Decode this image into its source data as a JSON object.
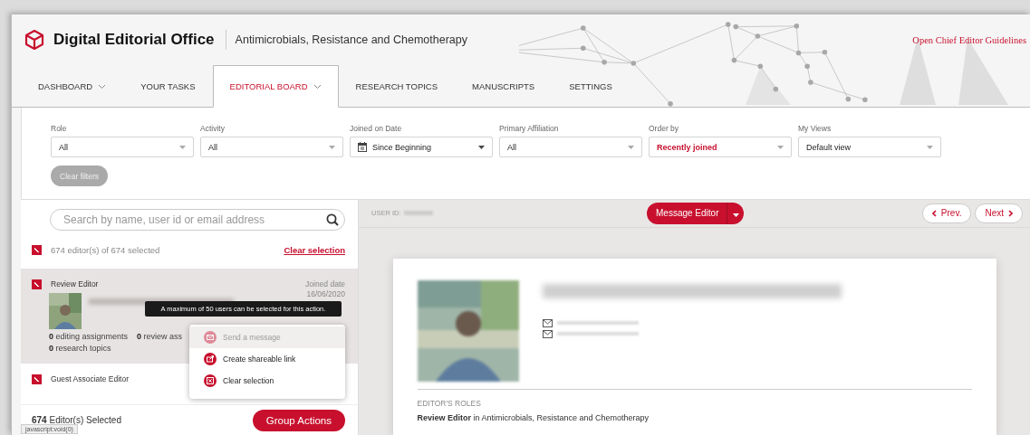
{
  "header": {
    "title": "Digital Editorial Office",
    "journal": "Antimicrobials, Resistance and Chemotherapy",
    "guidelines_link": "Open Chief Editor Guidelines"
  },
  "tabs": [
    {
      "label": "DASHBOARD",
      "dropdown": true,
      "selected": false
    },
    {
      "label": "YOUR TASKS",
      "dropdown": false,
      "selected": false
    },
    {
      "label": "EDITORIAL BOARD",
      "dropdown": true,
      "selected": true
    },
    {
      "label": "RESEARCH TOPICS",
      "dropdown": false,
      "selected": false
    },
    {
      "label": "MANUSCRIPTS",
      "dropdown": false,
      "selected": false
    },
    {
      "label": "SETTINGS",
      "dropdown": false,
      "selected": false
    }
  ],
  "filters": [
    {
      "label": "Role",
      "value": "All",
      "kind": "select",
      "highlighted": false
    },
    {
      "label": "Activity",
      "value": "All",
      "kind": "select",
      "highlighted": false
    },
    {
      "label": "Joined on Date",
      "value": "Since Beginning",
      "kind": "date",
      "highlighted": false
    },
    {
      "label": "Primary Affiliation",
      "value": "All",
      "kind": "select",
      "highlighted": false
    },
    {
      "label": "Order by",
      "value": "Recently joined",
      "kind": "select",
      "highlighted": true
    },
    {
      "label": "My Views",
      "value": "Default view",
      "kind": "select",
      "highlighted": false
    }
  ],
  "clear_filters": "Clear filters",
  "search": {
    "placeholder": "Search by name, user id or email address"
  },
  "selection": {
    "checked": true,
    "summary": "674 editor(s) of 674 selected",
    "clear": "Clear selection"
  },
  "editors": [
    {
      "role": "Review Editor",
      "checked": true,
      "selected": true,
      "joined_label": "Joined date",
      "joined": "16/06/2020",
      "stats": [
        "**0** editing assignments",
        "**0** review ass",
        "**0** research topics"
      ]
    },
    {
      "role": "Guest Associate Editor",
      "checked": true,
      "selected": false
    }
  ],
  "tooltip": "A maximum of 50 users can be selected for this action.",
  "menu": [
    {
      "label": "Send a message",
      "kind": "message",
      "disabled": true
    },
    {
      "label": "Create shareable link",
      "kind": "share",
      "disabled": false
    },
    {
      "label": "Clear selection",
      "kind": "clear",
      "disabled": false
    }
  ],
  "footer": {
    "count": "674",
    "label": "Editor(s) Selected",
    "button": "Group Actions"
  },
  "status_url": "javascript:void(0)",
  "detail": {
    "user_id_label": "USER ID:",
    "message_button": "Message Editor",
    "prev": "Prev.",
    "next": "Next",
    "roles_heading": "EDITOR'S ROLES",
    "roles": [
      "**Review Editor** in Antimicrobials, Resistance and Chemotherapy"
    ]
  }
}
